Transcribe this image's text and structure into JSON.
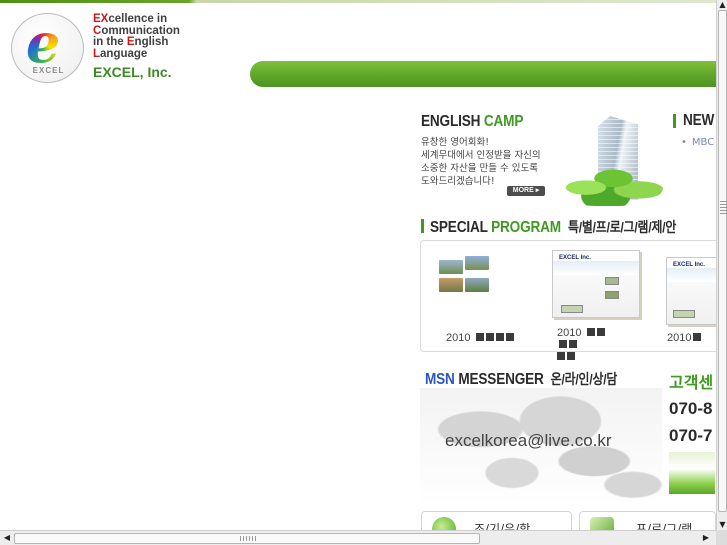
{
  "header": {
    "logo_word": "EXCEL",
    "tagline": [
      {
        "cap": "EX",
        "rest": "cellence in"
      },
      {
        "cap": "C",
        "rest": "ommunication"
      },
      {
        "cap": "",
        "rest": "in the "
      },
      {
        "cap": "L",
        "rest": "anguage"
      }
    ],
    "tagline_line3_cap": "E",
    "tagline_line3_rest": "nglish",
    "company": "EXCEL, Inc."
  },
  "english_camp": {
    "title_dark": "ENGLISH",
    "title_green": "CAMP",
    "lines": [
      "유창한 영어회화!",
      "세계무대에서 인정받을 자신의",
      "소중한 자산을 만들 수 있도록",
      "도와드리겠습니다!"
    ],
    "more_label": "MORE"
  },
  "news": {
    "title": "NEW",
    "items": [
      "MBC"
    ]
  },
  "special_program": {
    "title_dark": "SPECIAL",
    "title_green": "PROGRAM",
    "title_kor": "특/별/프/로/그/램/제/안",
    "items": [
      {
        "year": "2010",
        "blocks": 4
      },
      {
        "year": "2010",
        "blocks": 4
      },
      {
        "year": "2010",
        "blocks": 1
      }
    ],
    "slide_title": "EXCEL Inc."
  },
  "msn": {
    "title_blue": "MSN",
    "title_dark": "MESSENGER",
    "title_kor": "온/라/인/상/담",
    "email": "excelkorea@live.co.kr"
  },
  "customer_center": {
    "title": "고객센",
    "phones": [
      "070-8",
      "070-7"
    ]
  },
  "quick_links": [
    {
      "label": "조/기/유/학"
    },
    {
      "label": "프/로/그/램"
    }
  ],
  "colors": {
    "brand_green": "#3f9a22",
    "bar_green": "#5fa72a",
    "msn_blue": "#2a55c8",
    "tagline_red": "#c81a1a"
  }
}
